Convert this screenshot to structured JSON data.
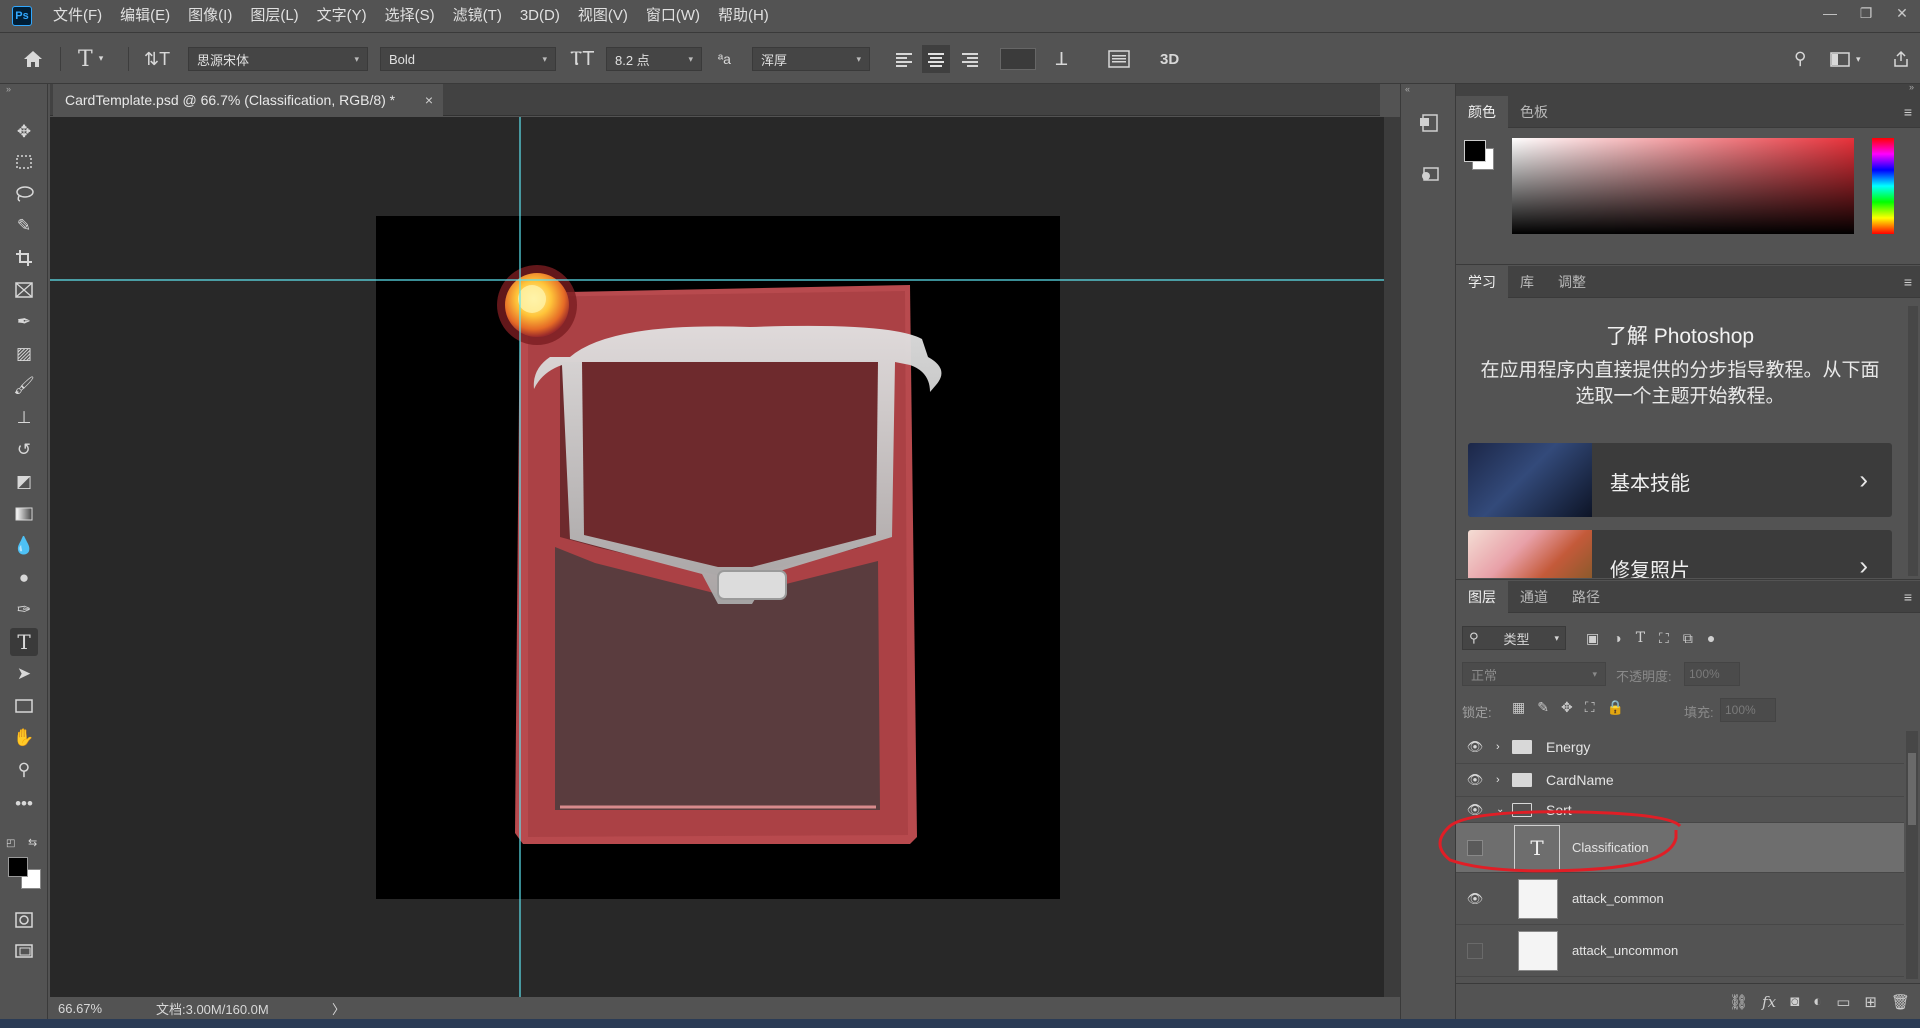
{
  "app": {
    "logo": "Ps",
    "menus": [
      "文件(F)",
      "编辑(E)",
      "图像(I)",
      "图层(L)",
      "文字(Y)",
      "选择(S)",
      "滤镜(T)",
      "3D(D)",
      "视图(V)",
      "窗口(W)",
      "帮助(H)"
    ],
    "window_controls": [
      "—",
      "❐",
      "✕"
    ]
  },
  "options": {
    "font_family": "思源宋体",
    "font_style": "Bold",
    "font_size": "8.2 点",
    "aa_label": "ªa",
    "antialias": "浑厚",
    "three_d": "3D"
  },
  "document": {
    "tab_title": "CardTemplate.psd @ 66.7% (Classification, RGB/8) *",
    "close": "×",
    "zoom": "66.67%",
    "doc_info": "文档:3.00M/160.0M",
    "status_arrow": "〉"
  },
  "color_panel": {
    "tabs": [
      "颜色",
      "色板"
    ],
    "foreground": "#000000",
    "background": "#ffffff",
    "hue": "#e8313a"
  },
  "learn_panel": {
    "tabs": [
      "学习",
      "库",
      "调整"
    ],
    "title": "了解 Photoshop",
    "description": "在应用程序内直接提供的分步指导教程。从下面选取一个主题开始教程。",
    "items": [
      {
        "label": "基本技能"
      },
      {
        "label": "修复照片"
      }
    ]
  },
  "layers_panel": {
    "tabs": [
      "图层",
      "通道",
      "路径"
    ],
    "filter_kind": "类型",
    "blend_mode": "正常",
    "opacity_label": "不透明度:",
    "opacity_value": "100%",
    "lock_label": "锁定:",
    "fill_label": "填充:",
    "fill_value": "100%",
    "layers": [
      {
        "name": "Energy",
        "type": "group",
        "visible": true,
        "expanded": false
      },
      {
        "name": "CardName",
        "type": "group",
        "visible": true,
        "expanded": false
      },
      {
        "name": "Sort",
        "type": "group",
        "visible": true,
        "expanded": true
      },
      {
        "name": "Classification",
        "type": "text",
        "visible": false,
        "selected": true
      },
      {
        "name": "attack_common",
        "type": "pixel",
        "visible": true
      },
      {
        "name": "attack_uncommon",
        "type": "pixel",
        "visible": false
      }
    ],
    "bottom_buttons": [
      "link-icon",
      "fx-icon",
      "mask-icon",
      "adjustment-icon",
      "group-icon",
      "new-layer-icon",
      "trash-icon"
    ]
  },
  "colors": {
    "ui_bg": "#535353",
    "canvas_bg": "#282828",
    "guide": "#5ee4f0",
    "card_red": "#b84a4e",
    "annotation": "#e01e26"
  }
}
